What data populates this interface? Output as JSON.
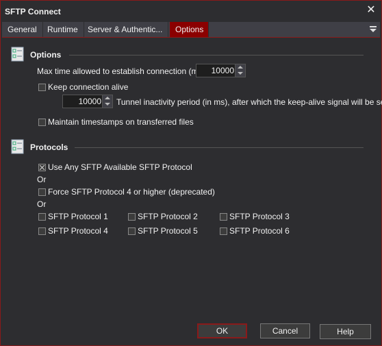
{
  "window": {
    "title": "SFTP Connect"
  },
  "tabs": [
    {
      "label": "General"
    },
    {
      "label": "Runtime"
    },
    {
      "label": "Server & Authentic..."
    },
    {
      "label": "Options"
    }
  ],
  "options": {
    "heading": "Options",
    "max_time_label": "Max time allowed to establish connection (ms):",
    "max_time_value": "10000",
    "keep_alive_label": "Keep connection alive",
    "keep_alive_checked": false,
    "tunnel_value": "10000",
    "tunnel_label": "Tunnel inactivity period (in ms), after which the keep-alive signal will be sent",
    "timestamps_label": "Maintain timestamps on transferred files",
    "timestamps_checked": false
  },
  "protocols": {
    "heading": "Protocols",
    "use_any_label": "Use Any SFTP Available SFTP Protocol",
    "use_any_checked": true,
    "or1": "Or",
    "force4_label": "Force SFTP Protocol 4 or higher (deprecated)",
    "force4_checked": false,
    "or2": "Or",
    "items": [
      {
        "label": "SFTP Protocol 1",
        "checked": false
      },
      {
        "label": "SFTP Protocol 2",
        "checked": false
      },
      {
        "label": "SFTP Protocol 3",
        "checked": false
      },
      {
        "label": "SFTP Protocol 4",
        "checked": false
      },
      {
        "label": "SFTP Protocol 5",
        "checked": false
      },
      {
        "label": "SFTP Protocol 6",
        "checked": false
      }
    ]
  },
  "buttons": {
    "ok": "OK",
    "cancel": "Cancel",
    "help": "Help"
  },
  "colors": {
    "accent": "#8b0000",
    "background": "#2d2d30"
  },
  "icons": {
    "close": "close-icon",
    "tab_menu": "menu-icon",
    "section": "checklist-icon"
  }
}
